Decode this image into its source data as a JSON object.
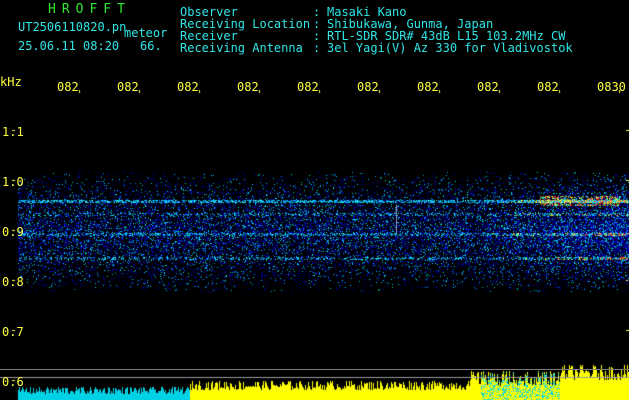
{
  "header": {
    "logo": "HROFFT",
    "filename": "UT2506110820.pn",
    "mode": "meteor",
    "datetime": "25.06.11 08:20",
    "count": "66.",
    "info": [
      {
        "label": "Observer",
        "sep": ":",
        "value": "Masaki Kano"
      },
      {
        "label": "Receiving Location",
        "sep": ":",
        "value": "Shibukawa, Gunma, Japan"
      },
      {
        "label": "Receiver",
        "sep": ":",
        "value": "RTL-SDR SDR# 43dB L15 103.2MHz CW"
      },
      {
        "label": "Receiving Antenna",
        "sep": ":",
        "value": "3el Yagi(V) Az 330 for Vladivostok"
      }
    ]
  },
  "axes": {
    "y_unit": "kHz",
    "y_ticks": [
      "1.1",
      "1.0",
      "0.9",
      "0.8",
      "0.7",
      "0.6"
    ],
    "x_ticks": [
      "082",
      "082",
      "082",
      "082",
      "082",
      "082",
      "082",
      "082",
      "082",
      "0830"
    ]
  },
  "colors": {
    "background": "#000000",
    "label_text": "#2ee6e6",
    "value_text": "#e8e8e8",
    "logo": "#2ee62e",
    "time_ticks": "#ffff40",
    "meter_yellow": "#ffff00",
    "meter_cyan": "#00e0e0"
  }
}
